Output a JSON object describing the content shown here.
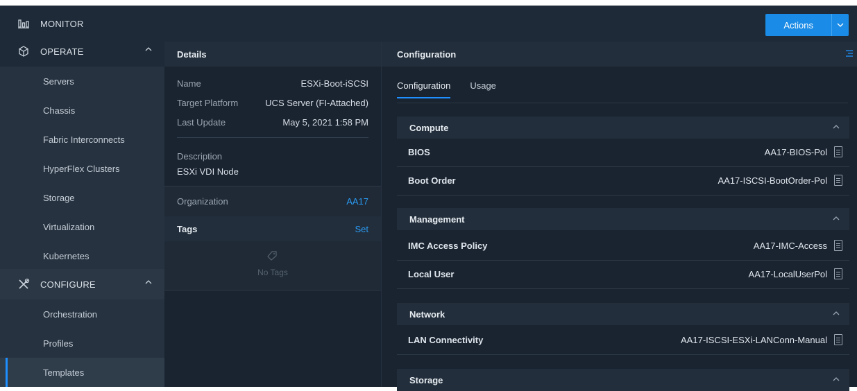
{
  "sidebar": {
    "monitor_label": "MONITOR",
    "operate_label": "OPERATE",
    "operate_items": [
      "Servers",
      "Chassis",
      "Fabric Interconnects",
      "HyperFlex Clusters",
      "Storage",
      "Virtualization",
      "Kubernetes"
    ],
    "configure_label": "CONFIGURE",
    "configure_items": [
      "Orchestration",
      "Profiles",
      "Templates"
    ]
  },
  "topbar": {
    "actions_label": "Actions"
  },
  "details": {
    "title": "Details",
    "name_label": "Name",
    "name_value": "ESXi-Boot-iSCSI",
    "platform_label": "Target Platform",
    "platform_value": "UCS Server (FI-Attached)",
    "update_label": "Last Update",
    "update_value": "May 5, 2021 1:58 PM",
    "description_label": "Description",
    "description_value": "ESXi VDI Node",
    "organization_label": "Organization",
    "organization_value": "AA17",
    "tags_label": "Tags",
    "tags_set": "Set",
    "no_tags": "No Tags"
  },
  "config": {
    "title": "Configuration",
    "tabs": [
      "Configuration",
      "Usage"
    ],
    "sections": [
      {
        "name": "Compute",
        "rows": [
          {
            "label": "BIOS",
            "value": "AA17-BIOS-Pol"
          },
          {
            "label": "Boot Order",
            "value": "AA17-ISCSI-BootOrder-Pol"
          }
        ]
      },
      {
        "name": "Management",
        "rows": [
          {
            "label": "IMC Access Policy",
            "value": "AA17-IMC-Access"
          },
          {
            "label": "Local User",
            "value": "AA17-LocalUserPol"
          }
        ]
      },
      {
        "name": "Network",
        "rows": [
          {
            "label": "LAN Connectivity",
            "value": "AA17-ISCSI-ESXi-LANConn-Manual"
          }
        ]
      },
      {
        "name": "Storage",
        "rows": []
      }
    ]
  },
  "colors": {
    "accent": "#1e90ff",
    "bg": "#1a2430",
    "sidebar": "#1e2a37"
  }
}
